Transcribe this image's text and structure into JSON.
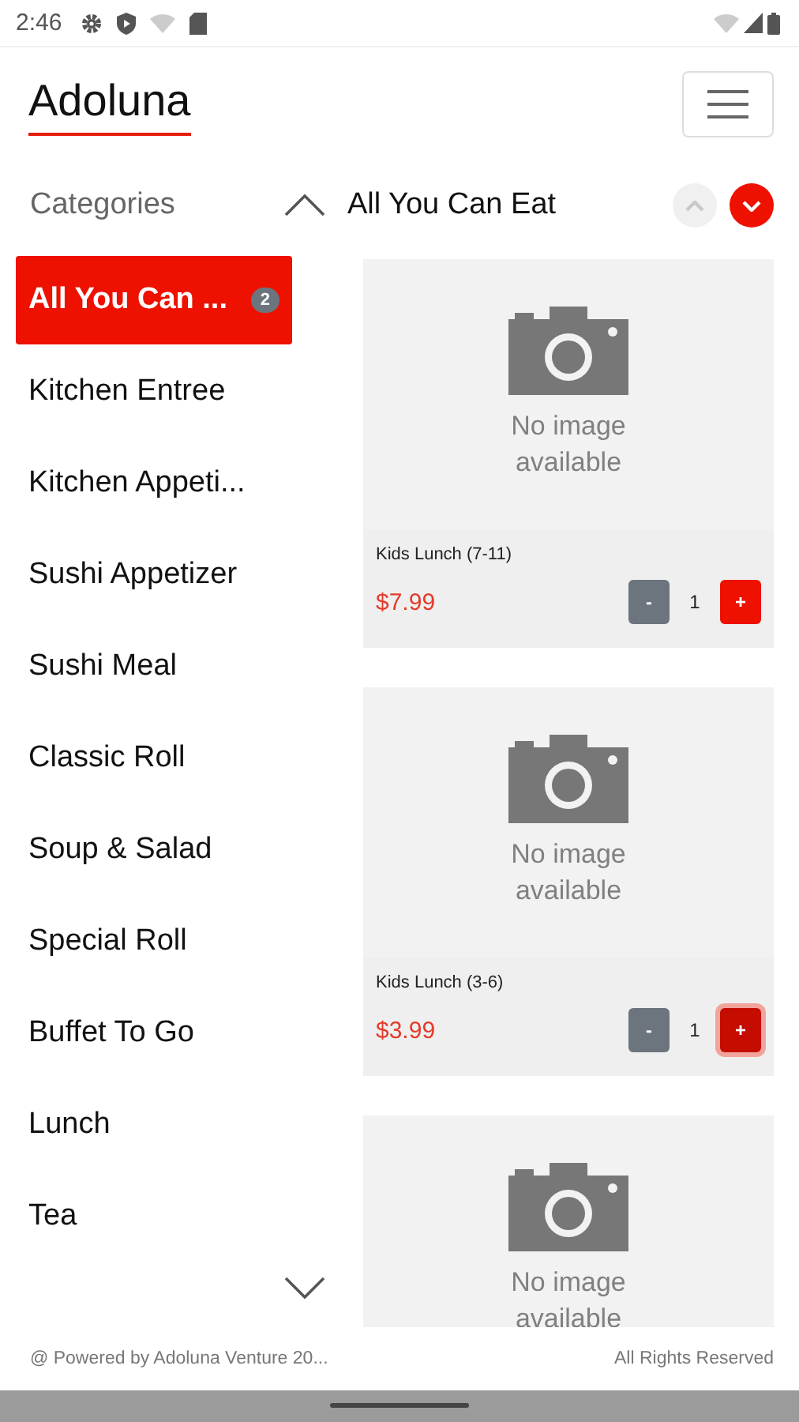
{
  "status_bar": {
    "time": "2:46"
  },
  "header": {
    "logo": "Adoluna"
  },
  "categories": {
    "title": "Categories",
    "items": [
      {
        "label": "All You Can ...",
        "badge": "2",
        "selected": true
      },
      {
        "label": "Kitchen Entree",
        "selected": false
      },
      {
        "label": "Kitchen Appeti...",
        "selected": false
      },
      {
        "label": "Sushi Appetizer",
        "selected": false
      },
      {
        "label": "Sushi Meal",
        "selected": false
      },
      {
        "label": "Classic Roll",
        "selected": false
      },
      {
        "label": "Soup & Salad",
        "selected": false
      },
      {
        "label": "Special Roll",
        "selected": false
      },
      {
        "label": "Buffet To Go",
        "selected": false
      },
      {
        "label": "Lunch",
        "selected": false
      },
      {
        "label": "Tea",
        "selected": false
      }
    ]
  },
  "section": {
    "title": "All You Can Eat",
    "up_disabled": true,
    "down_disabled": false
  },
  "products": [
    {
      "image_text": "No image available",
      "name": "Kids Lunch (7-11)",
      "price": "$7.99",
      "minus": "-",
      "quantity": "1",
      "plus": "+",
      "plus_focused": false
    },
    {
      "image_text": "No image available",
      "name": "Kids Lunch (3-6)",
      "price": "$3.99",
      "minus": "-",
      "quantity": "1",
      "plus": "+",
      "plus_focused": true
    },
    {
      "image_text": "No image available"
    }
  ],
  "footer": {
    "left": "@ Powered by Adoluna Venture 20...",
    "right": "All Rights Reserved"
  }
}
